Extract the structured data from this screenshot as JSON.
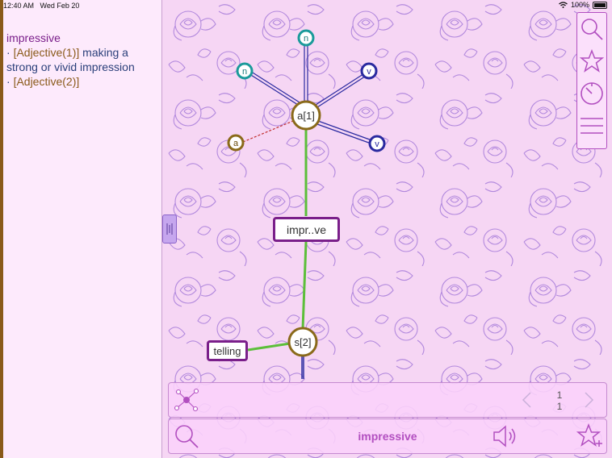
{
  "status": {
    "time": "12:40 AM",
    "date": "Wed Feb 20",
    "battery": "100%"
  },
  "definition": {
    "word": "impressive",
    "entries": [
      {
        "pos": "[Adjective(1)]",
        "gloss": "making a strong or vivid impression"
      },
      {
        "pos": "[Adjective(2)]",
        "gloss": ""
      }
    ]
  },
  "graph": {
    "nodes": {
      "n1": "n",
      "n2": "n",
      "v1": "v",
      "v2": "v",
      "a_side": "a",
      "a1": "a[1]",
      "s2": "s[2]"
    },
    "center_word": "impr..ve",
    "linked_word": "telling"
  },
  "bottom": {
    "search_word": "impressive",
    "page_current": "1",
    "page_total": "1"
  },
  "colors": {
    "accent": "#b24fc0",
    "teal": "#1a9a9a",
    "navy": "#2a2aa0",
    "gold": "#8a6a1a",
    "green": "#5cbf3a"
  },
  "icons": [
    "search-icon",
    "star-icon",
    "timer-icon",
    "menu-icon",
    "graph-icon",
    "speaker-icon",
    "star-plus-icon",
    "chevron-left-icon",
    "chevron-right-icon"
  ]
}
